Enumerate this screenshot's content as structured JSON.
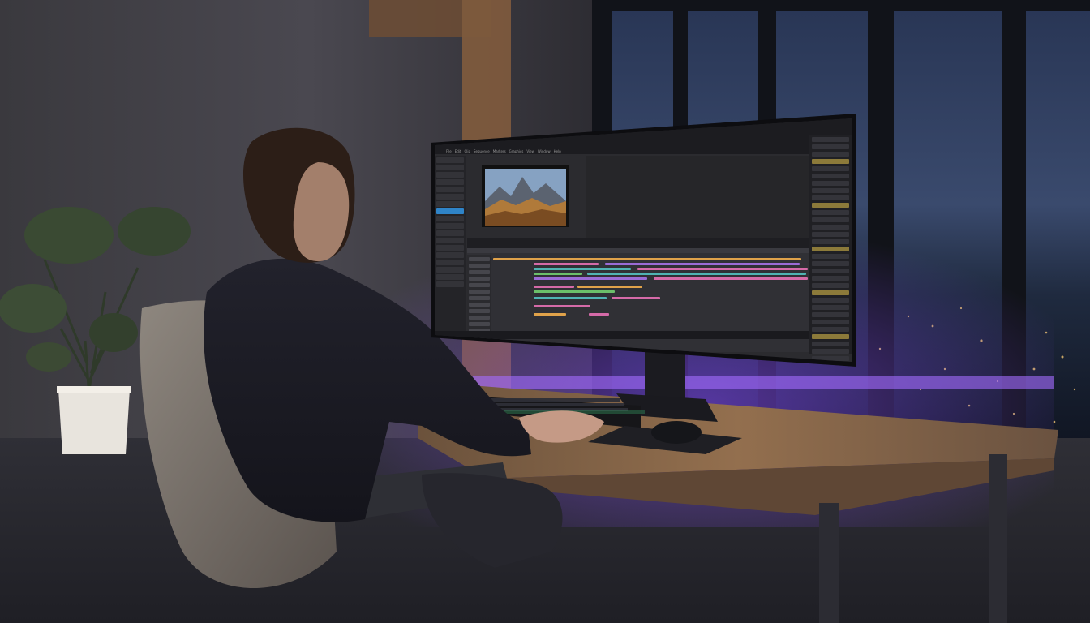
{
  "scene": {
    "description_tag": "photo",
    "colors": {
      "wall": "#3a393e",
      "window_sky": "#2d3a5a",
      "city_lights": "#d9b36a",
      "desk_wood": "#8a6a4a",
      "underglow": "#8a4dff",
      "monitor_bezel": "#0d0d10",
      "ui_accent_blue": "#2f84c8",
      "clip_pink": "#d56aa8",
      "clip_orange": "#e0a24a",
      "clip_teal": "#4fb3b3",
      "clip_green": "#6bbf6a",
      "clip_purple": "#9a6bd6"
    }
  },
  "editor_ui": {
    "menu_labels": [
      "File",
      "Edit",
      "Clip",
      "Sequence",
      "Markers",
      "Graphics",
      "View",
      "Window",
      "Help"
    ],
    "left_panel_items": 18,
    "selected_left_item_index": 7,
    "right_panel_rows": 34,
    "timeline_tracks": 12
  }
}
